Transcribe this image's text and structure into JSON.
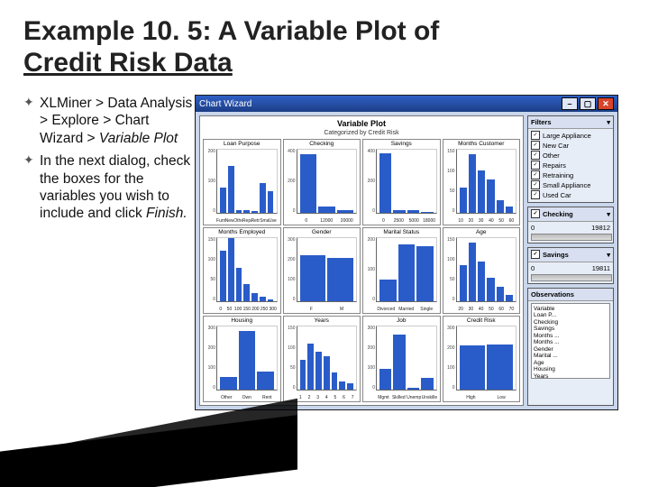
{
  "title": {
    "prefix": "Example 10. 5: A Variable Plot of",
    "underlined": "Credit Risk Data"
  },
  "bullets": [
    {
      "html": "XLMiner > Data Analysis > Explore > Chart Wizard > <em>Variable Plot</em>"
    },
    {
      "html": "In the next dialog, check the boxes for the variables you wish to include and click <em>Finish.</em>"
    }
  ],
  "window": {
    "title": "Chart Wizard",
    "plot_title": "Variable Plot",
    "plot_sub": "Categorized by Credit Risk",
    "side": {
      "filters": {
        "header": "Filters",
        "items": [
          {
            "label": "Large Appliance",
            "checked": true
          },
          {
            "label": "New Car",
            "checked": true
          },
          {
            "label": "Other",
            "checked": true
          },
          {
            "label": "Repairs",
            "checked": true
          },
          {
            "label": "Retraining",
            "checked": true
          },
          {
            "label": "Small Appliance",
            "checked": true
          },
          {
            "label": "Used Car",
            "checked": true
          }
        ]
      },
      "checking": {
        "header": "Checking",
        "max": "19812"
      },
      "savings": {
        "header": "Savings",
        "max": "19811"
      },
      "observations": {
        "header": "Observations",
        "list": [
          "Variable",
          "Loan P...",
          "Checking",
          "Savings",
          "Months ...",
          "Months ...",
          "Gender",
          "Marital ...",
          "Age",
          "Housing",
          "Years",
          "Job",
          "Credit Risk"
        ]
      }
    }
  },
  "chart_data": [
    {
      "type": "bar",
      "title": "Loan Purpose",
      "categories": [
        "FurnAppl",
        "New Car",
        "Other",
        "Repairs",
        "Retrain",
        "SmallAppl",
        "Used Car"
      ],
      "values": [
        80,
        150,
        10,
        10,
        5,
        95,
        70
      ],
      "ylim": [
        0,
        200
      ],
      "yticks": [
        0,
        100,
        200
      ]
    },
    {
      "type": "bar",
      "title": "Checking",
      "categories": [
        "0",
        "12000",
        "20000"
      ],
      "values": [
        370,
        40,
        15
      ],
      "ylim": [
        0,
        400
      ],
      "yticks": [
        0,
        200,
        400
      ]
    },
    {
      "type": "bar",
      "title": "Savings",
      "categories": [
        "0",
        "2500",
        "5000",
        "18000"
      ],
      "values": [
        380,
        20,
        20,
        5
      ],
      "ylim": [
        0,
        400
      ],
      "yticks": [
        0,
        200,
        400
      ]
    },
    {
      "type": "bar",
      "title": "Months Customer",
      "categories": [
        "10",
        "20",
        "30",
        "40",
        "50",
        "60"
      ],
      "values": [
        60,
        140,
        100,
        80,
        30,
        15
      ],
      "ylim": [
        0,
        150
      ],
      "yticks": [
        0,
        50,
        100,
        150
      ]
    },
    {
      "type": "bar",
      "title": "Months Employed",
      "categories": [
        "0",
        "50",
        "100",
        "150",
        "200",
        "250",
        "300"
      ],
      "values": [
        120,
        150,
        80,
        40,
        20,
        10,
        5
      ],
      "ylim": [
        0,
        150
      ],
      "yticks": [
        0,
        50,
        100,
        150
      ]
    },
    {
      "type": "bar",
      "title": "Gender",
      "categories": [
        "F",
        "M"
      ],
      "values": [
        220,
        205
      ],
      "ylim": [
        0,
        300
      ],
      "yticks": [
        0,
        100,
        200,
        300
      ]
    },
    {
      "type": "bar",
      "title": "Marital Status",
      "categories": [
        "Divorced",
        "Married",
        "Single"
      ],
      "values": [
        70,
        180,
        175
      ],
      "ylim": [
        0,
        200
      ],
      "yticks": [
        0,
        100,
        200
      ]
    },
    {
      "type": "bar",
      "title": "Age",
      "categories": [
        "20",
        "30",
        "40",
        "50",
        "60",
        "70"
      ],
      "values": [
        85,
        140,
        95,
        55,
        35,
        15
      ],
      "ylim": [
        0,
        150
      ],
      "yticks": [
        0,
        50,
        100,
        150
      ]
    },
    {
      "type": "bar",
      "title": "Housing",
      "categories": [
        "Other",
        "Own",
        "Rent"
      ],
      "values": [
        60,
        280,
        85
      ],
      "ylim": [
        0,
        300
      ],
      "yticks": [
        0,
        100,
        200,
        300
      ]
    },
    {
      "type": "bar",
      "title": "Years",
      "categories": [
        "1",
        "2",
        "3",
        "4",
        "5",
        "6",
        "7"
      ],
      "values": [
        70,
        110,
        90,
        80,
        40,
        20,
        15
      ],
      "ylim": [
        0,
        150
      ],
      "yticks": [
        0,
        50,
        100,
        150
      ]
    },
    {
      "type": "bar",
      "title": "Job",
      "categories": [
        "Mgmt",
        "Skilled",
        "Unemp",
        "Unskilled"
      ],
      "values": [
        100,
        260,
        10,
        55
      ],
      "ylim": [
        0,
        300
      ],
      "yticks": [
        0,
        100,
        200,
        300
      ]
    },
    {
      "type": "bar",
      "title": "Credit Risk",
      "categories": [
        "High",
        "Low"
      ],
      "values": [
        210,
        215
      ],
      "ylim": [
        0,
        300
      ],
      "yticks": [
        0,
        100,
        200,
        300
      ]
    }
  ]
}
